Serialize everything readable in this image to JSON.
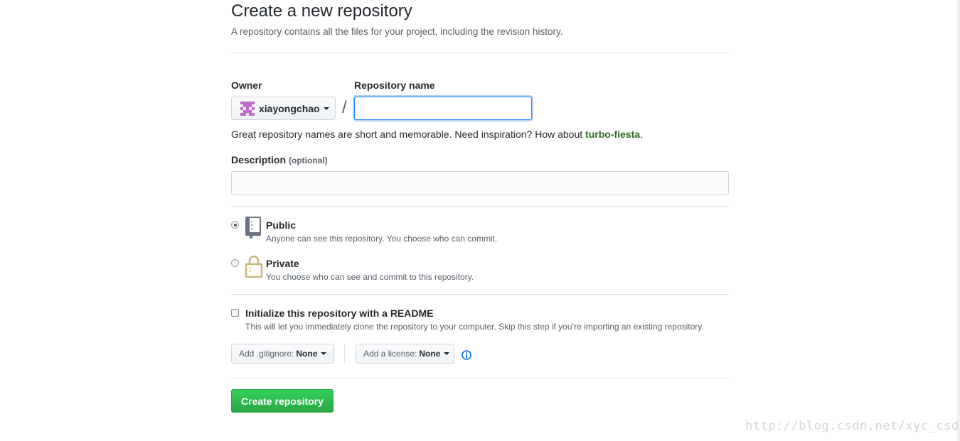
{
  "page": {
    "title": "Create a new repository",
    "subtitle": "A repository contains all the files for your project, including the revision history."
  },
  "form": {
    "owner_label": "Owner",
    "owner_value": "xiayongchao",
    "repo_label": "Repository name",
    "repo_value": "",
    "slash": "/",
    "hint_prefix": "Great repository names are short and memorable. Need inspiration? How about ",
    "hint_suggestion": "turbo-fiesta",
    "hint_suffix": ".",
    "description_label": "Description",
    "description_optional": "(optional)",
    "description_value": ""
  },
  "visibility": {
    "selected": "public",
    "public_title": "Public",
    "public_desc": "Anyone can see this repository. You choose who can commit.",
    "private_title": "Private",
    "private_desc": "You choose who can see and commit to this repository."
  },
  "init": {
    "readme_title": "Initialize this repository with a README",
    "readme_desc": "This will let you immediately clone the repository to your computer. Skip this step if you’re importing an existing repository.",
    "readme_checked": false,
    "gitignore_prefix": "Add .gitignore:",
    "gitignore_value": "None",
    "license_prefix": "Add a license:",
    "license_value": "None"
  },
  "actions": {
    "create_label": "Create repository"
  },
  "watermark": "http://blog.csdn.net/xyc_csdn",
  "icons": {
    "owner_avatar": "identicon-avatar",
    "public": "repo-book-icon",
    "private": "lock-icon",
    "info": "info-icon"
  },
  "colors": {
    "primary_green": "#28a745",
    "suggestion_green": "#2b6a1e",
    "focus_blue": "#2188ff",
    "avatar_purple": "#c06bd0",
    "lock_tan": "#c9b47c"
  }
}
